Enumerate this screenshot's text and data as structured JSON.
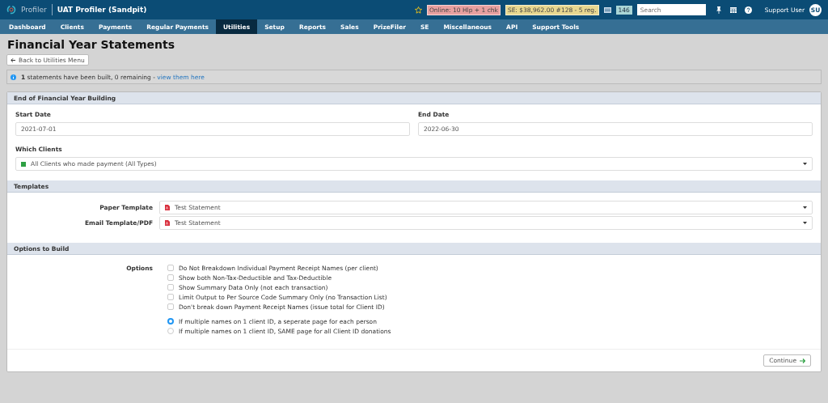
{
  "header": {
    "brand": "Profiler",
    "app_title": "UAT Profiler (Sandpit)",
    "badges": [
      {
        "text": "Online: 10 Hlp + 1 chk",
        "color": "#e8a0a0"
      },
      {
        "text": "SE: $38,962.00 #128 - 5 reg.",
        "color": "#e8d890"
      }
    ],
    "count": "146",
    "search": {
      "placeholder": "Search"
    },
    "user": "Support User",
    "avatar": "SU"
  },
  "nav": [
    {
      "label": "Dashboard",
      "selected": false
    },
    {
      "label": "Clients",
      "selected": false
    },
    {
      "label": "Payments",
      "selected": false
    },
    {
      "label": "Regular Payments",
      "selected": false
    },
    {
      "label": "Utilities",
      "selected": true
    },
    {
      "label": "Setup",
      "selected": false
    },
    {
      "label": "Reports",
      "selected": false
    },
    {
      "label": "Sales",
      "selected": false
    },
    {
      "label": "PrizeFiler",
      "selected": false
    },
    {
      "label": "SE",
      "selected": false
    },
    {
      "label": "Miscellaneous",
      "selected": false
    },
    {
      "label": "API",
      "selected": false
    },
    {
      "label": "Support Tools",
      "selected": false
    }
  ],
  "page_title": "Financial Year Statements",
  "back_button": "Back to Utilities Menu",
  "alert": {
    "text": "**1** statements have been built, 0 remaining - ",
    "link": "view them here"
  },
  "sections": [
    {
      "title": "End of Financial Year Building",
      "start_label": "Start Date",
      "start_value": "2021-07-01",
      "end_label": "End Date",
      "end_value": "2022-06-30",
      "clients_label": "Which Clients",
      "clients_value": "All Clients who made payment (All Types)"
    },
    {
      "title": "Templates",
      "rows": [
        {
          "label": "Paper Template",
          "value": "Test Statement"
        },
        {
          "label": "Email Template/PDF",
          "value": "Test Statement"
        }
      ]
    },
    {
      "title": "Options to Build",
      "label": "Options",
      "checkboxes": [
        {
          "label": "Do Not Breakdown Individual Payment Receipt Names (per client)",
          "checked": false
        },
        {
          "label": "Show both Non-Tax-Deductible and Tax-Deductible",
          "checked": false
        },
        {
          "label": "Show Summary Data Only (not each transaction)",
          "checked": false
        },
        {
          "label": "Limit Output to Per Source Code Summary Only (no Transaction List)",
          "checked": false
        },
        {
          "label": "Don't break down Payment Receipt Names (issue total for Client ID)",
          "checked": false
        }
      ],
      "radios": [
        {
          "label": "If multiple names on 1 client ID, a seperate page for each person",
          "selected": true
        },
        {
          "label": "If multiple names on 1 client ID, SAME page for all Client ID donations",
          "selected": false
        }
      ]
    }
  ],
  "continue_button": "Continue"
}
